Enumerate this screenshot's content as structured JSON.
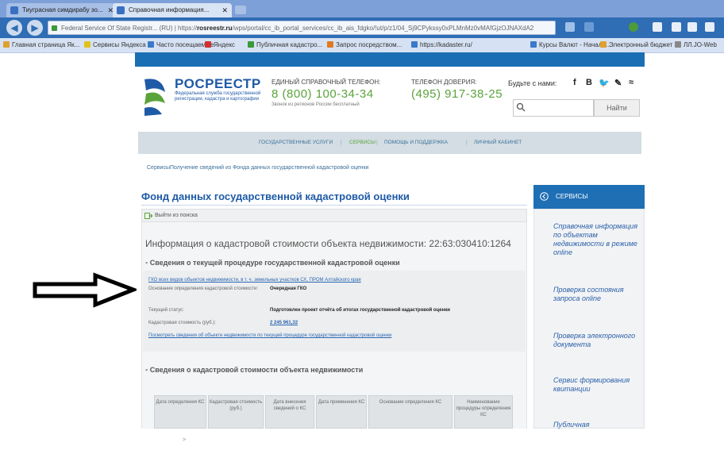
{
  "browser": {
    "tabs": [
      {
        "label": "Тиуграсная cимдирабу зо...",
        "active": false
      },
      {
        "label": "Справочная информация...",
        "active": true
      }
    ],
    "url_host": "Federal Service Of State Registr... (RU)",
    "url_prefix": "https://",
    "url_domain": "rosreestr.ru",
    "url_rest": "/wps/portal/cc_ib_portal_services/cc_ib_ais_fdgko/!ut/p/z1/04_Sj9CPykssy0xPLMnMz0vMAfGjzOJNAXdA2",
    "bookmarks": [
      "Главная страница Як...",
      "Сервисы Яндекса",
      "Часто посещаемые",
      "Яндекс",
      "Публичная кадастро...",
      "Запрос посредством...",
      "https://kadaster.ru/",
      "Курсы Валют - Начало...",
      "Электронный бюджет",
      "ЛЛ.JO-Web"
    ]
  },
  "header": {
    "logo_title": "РОСРЕЕСТР",
    "logo_subtitle": "Федеральная служба государственной регистрации, кадастра и картографии",
    "hotline_label": "ЕДИНЫЙ СПРАВОЧНЫЙ ТЕЛЕФОН:",
    "hotline_number": "8 (800) 100-34-34",
    "hotline_note": "Звонок из регионов России бесплатный",
    "trust_label": "ТЕЛЕФОН ДОВЕРИЯ:",
    "trust_number": "(495) 917-38-25",
    "social_label": "Будьте с нами:",
    "search_button": "Найти",
    "search_placeholder": ""
  },
  "nav": {
    "items": [
      "ГОСУДАРСТВЕННЫЕ УСЛУГИ",
      "СЕРВИСЫ",
      "ПОМОЩЬ И ПОДДЕРЖКА",
      "ЛИЧНЫЙ КАБИНЕТ"
    ],
    "separator": "|"
  },
  "breadcrumb": {
    "root": "Сервисы",
    "arrow": ">",
    "current": "Получение сведений из Фонда данных государственной кадастровой оценки"
  },
  "page": {
    "title": "Фонд данных государственной кадастровой оценки",
    "exit_search": "Выйти из поиска",
    "object_title": "Информация о кадастровой стоимости объекта недвижимости: 22:63:030410:1264",
    "section1_title": "Сведения о текущей процедуре государственной кадастровой оценки",
    "gko_link": "ГКО всех видов объектов недвижимости, в т. ч. земельных участков СХ, ПРОМ Алтайского края",
    "fields": [
      {
        "label": "Основание определения кадастровой стоимости:",
        "value": "Очередная ГКО",
        "is_link": false
      },
      {
        "label": "Текущий статус:",
        "value": "Подготовлен проект отчёта об итогах государственной кадастровой оценки",
        "is_link": false
      },
      {
        "label": "Кадастровая стоимость (руб.):",
        "value": "2 245 961,32",
        "is_link": true
      }
    ],
    "details_link": "Посмотреть сведения об объекте недвижимости по текущей процедуре государственной кадастровой оценки",
    "section2_title": "Сведения о кадастровой стоимости объекта недвижимости",
    "table_headers": [
      "Дата определения КС",
      "Кадастровая стоимость (руб.)",
      "Дата внесения сведений о КС",
      "Дата применения КС",
      "Основание определения КС",
      "Наименование процедуры определения КС"
    ]
  },
  "sidebar": {
    "title": "СЕРВИСЫ",
    "links": [
      "Справочная информация по объектам недвижимости в режиме online",
      "Проверка состояния запроса online",
      "Проверка электронного документа",
      "Сервис формирования квитанции",
      "Публичная"
    ]
  },
  "colors": {
    "brand_blue": "#1f5aa6",
    "phone_green": "#5aa33b",
    "sidebar_blue": "#1f6fb5"
  }
}
